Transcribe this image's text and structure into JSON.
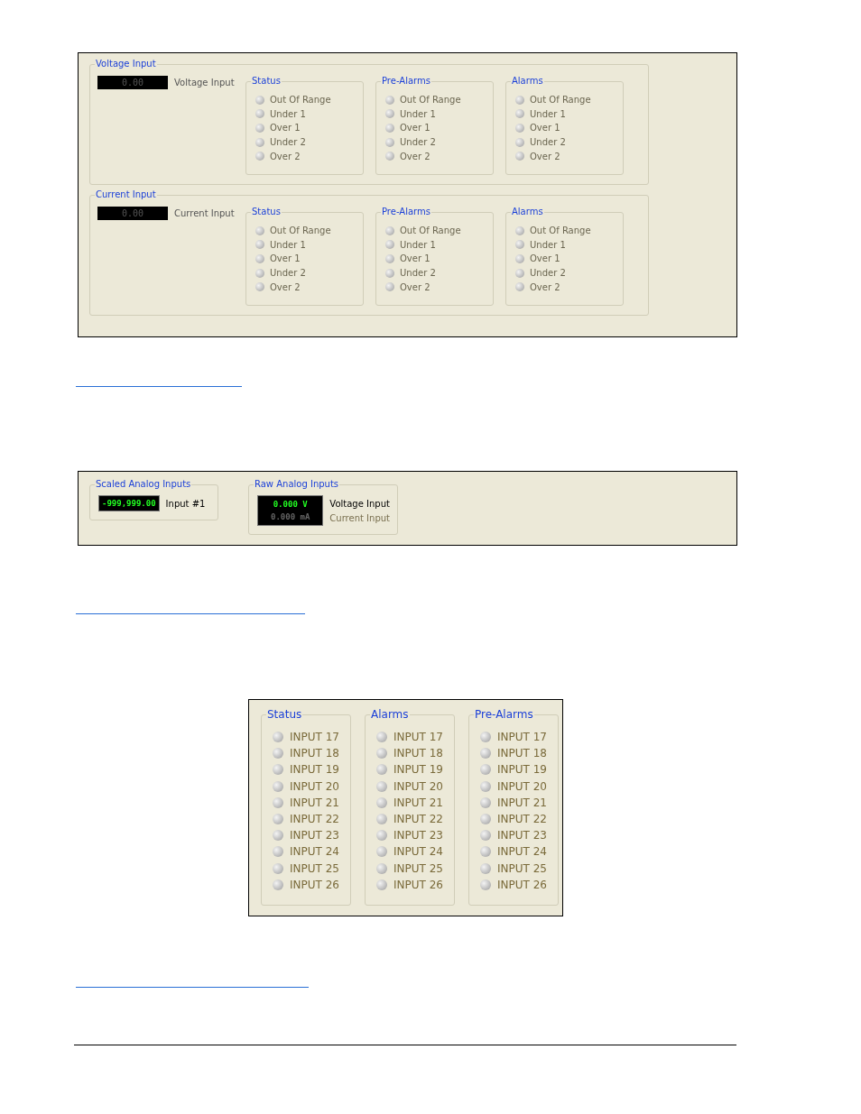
{
  "panels": [
    {
      "kind": "input_groups",
      "groups": [
        {
          "title": "Voltage Input",
          "display": {
            "value": "0.00",
            "lit": false
          },
          "label": "Voltage Input",
          "sections": [
            {
              "title": "Status",
              "leds": [
                {
                  "label": "Out Of Range",
                  "on": false
                },
                {
                  "label": "Under 1",
                  "on": false
                },
                {
                  "label": "Over 1",
                  "on": false
                },
                {
                  "label": "Under 2",
                  "on": false
                },
                {
                  "label": "Over 2",
                  "on": false
                }
              ]
            },
            {
              "title": "Pre-Alarms",
              "leds": [
                {
                  "label": "Out Of Range",
                  "on": false
                },
                {
                  "label": "Under 1",
                  "on": false
                },
                {
                  "label": "Over 1",
                  "on": false
                },
                {
                  "label": "Under 2",
                  "on": false
                },
                {
                  "label": "Over 2",
                  "on": false
                }
              ]
            },
            {
              "title": "Alarms",
              "leds": [
                {
                  "label": "Out Of Range",
                  "on": false
                },
                {
                  "label": "Under 1",
                  "on": false
                },
                {
                  "label": "Over 1",
                  "on": false
                },
                {
                  "label": "Under 2",
                  "on": false
                },
                {
                  "label": "Over 2",
                  "on": false
                }
              ]
            }
          ]
        },
        {
          "title": "Current Input",
          "display": {
            "value": "0.00",
            "lit": false
          },
          "label": "Current Input",
          "sections": [
            {
              "title": "Status",
              "leds": [
                {
                  "label": "Out Of Range",
                  "on": false
                },
                {
                  "label": "Under 1",
                  "on": false
                },
                {
                  "label": "Over 1",
                  "on": false
                },
                {
                  "label": "Under 2",
                  "on": false
                },
                {
                  "label": "Over 2",
                  "on": false
                }
              ]
            },
            {
              "title": "Pre-Alarms",
              "leds": [
                {
                  "label": "Out Of Range",
                  "on": false
                },
                {
                  "label": "Under 1",
                  "on": false
                },
                {
                  "label": "Over 1",
                  "on": false
                },
                {
                  "label": "Under 2",
                  "on": false
                },
                {
                  "label": "Over 2",
                  "on": false
                }
              ]
            },
            {
              "title": "Alarms",
              "leds": [
                {
                  "label": "Out Of Range",
                  "on": false
                },
                {
                  "label": "Under 1",
                  "on": false
                },
                {
                  "label": "Over 1",
                  "on": false
                },
                {
                  "label": "Under 2",
                  "on": false
                },
                {
                  "label": "Over 2",
                  "on": false
                }
              ]
            }
          ]
        }
      ]
    },
    {
      "kind": "analog",
      "groups": [
        {
          "title": "Scaled Analog Inputs",
          "readings": [
            {
              "value": "-999,999.00",
              "lit": true,
              "label": "Input #1"
            }
          ]
        },
        {
          "title": "Raw Analog Inputs",
          "readings": [
            {
              "value": "0.000 V",
              "lit": true,
              "label": "Voltage Input"
            },
            {
              "value": "0.000 mA",
              "lit": false,
              "label": "Current Input"
            }
          ]
        }
      ]
    },
    {
      "kind": "led_columns",
      "sections": [
        {
          "title": "Status",
          "leds": [
            {
              "label": "INPUT 17",
              "on": false
            },
            {
              "label": "INPUT 18",
              "on": false
            },
            {
              "label": "INPUT 19",
              "on": false
            },
            {
              "label": "INPUT 20",
              "on": false
            },
            {
              "label": "INPUT 21",
              "on": false
            },
            {
              "label": "INPUT 22",
              "on": false
            },
            {
              "label": "INPUT 23",
              "on": false
            },
            {
              "label": "INPUT 24",
              "on": false
            },
            {
              "label": "INPUT 25",
              "on": false
            },
            {
              "label": "INPUT 26",
              "on": false
            }
          ]
        },
        {
          "title": "Alarms",
          "leds": [
            {
              "label": "INPUT 17",
              "on": false
            },
            {
              "label": "INPUT 18",
              "on": false
            },
            {
              "label": "INPUT 19",
              "on": false
            },
            {
              "label": "INPUT 20",
              "on": false
            },
            {
              "label": "INPUT 21",
              "on": false
            },
            {
              "label": "INPUT 22",
              "on": false
            },
            {
              "label": "INPUT 23",
              "on": false
            },
            {
              "label": "INPUT 24",
              "on": false
            },
            {
              "label": "INPUT 25",
              "on": false
            },
            {
              "label": "INPUT 26",
              "on": false
            }
          ]
        },
        {
          "title": "Pre-Alarms",
          "leds": [
            {
              "label": "INPUT 17",
              "on": false
            },
            {
              "label": "INPUT 18",
              "on": false
            },
            {
              "label": "INPUT 19",
              "on": false
            },
            {
              "label": "INPUT 20",
              "on": false
            },
            {
              "label": "INPUT 21",
              "on": false
            },
            {
              "label": "INPUT 22",
              "on": false
            },
            {
              "label": "INPUT 23",
              "on": false
            },
            {
              "label": "INPUT 24",
              "on": false
            },
            {
              "label": "INPUT 25",
              "on": false
            },
            {
              "label": "INPUT 26",
              "on": false
            }
          ]
        }
      ]
    }
  ]
}
